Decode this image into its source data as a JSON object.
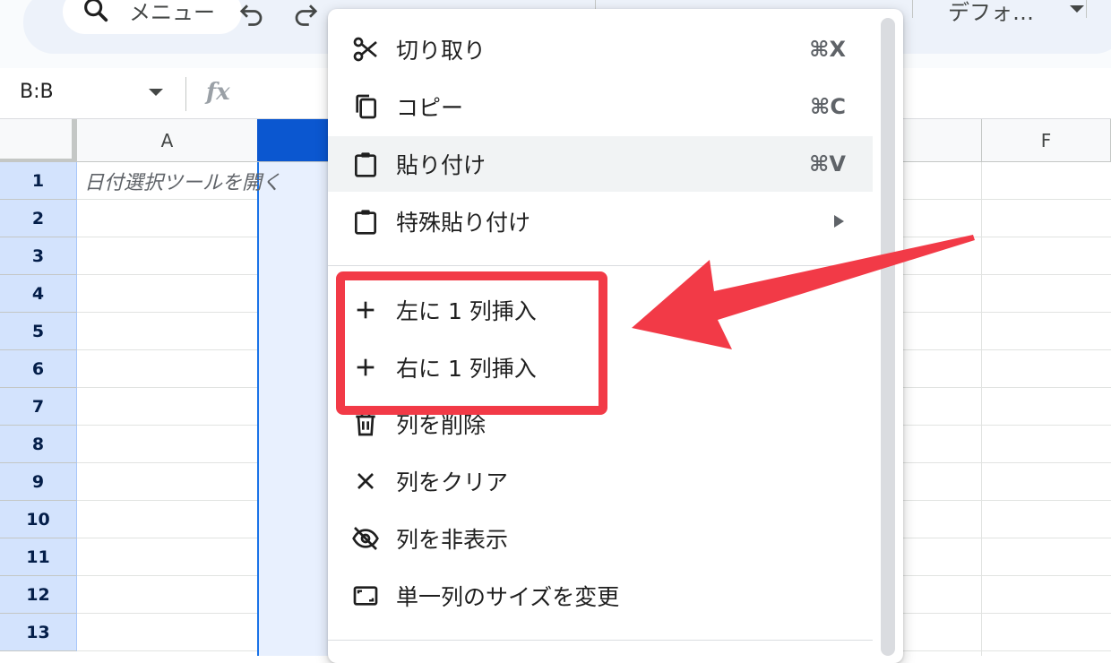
{
  "toolbar": {
    "search_label": "メニュー",
    "font_label": "デフォ…"
  },
  "formula_bar": {
    "name_box": "B:B",
    "fx": "fx"
  },
  "grid": {
    "columns": [
      "A",
      "",
      "",
      "",
      "",
      "F"
    ],
    "rows": [
      "1",
      "2",
      "3",
      "4",
      "5",
      "6",
      "7",
      "8",
      "9",
      "10",
      "11",
      "12",
      "13"
    ],
    "cell_A1": "日付選択ツールを開く"
  },
  "context_menu": {
    "items": [
      {
        "label": "切り取り",
        "shortcut": "⌘X",
        "icon": "scissors-icon"
      },
      {
        "label": "コピー",
        "shortcut": "⌘C",
        "icon": "copy-icon"
      },
      {
        "label": "貼り付け",
        "shortcut": "⌘V",
        "icon": "paste-icon"
      },
      {
        "label": "特殊貼り付け",
        "shortcut": "",
        "icon": "paste-special-icon"
      },
      {
        "label": "左に 1 列挿入",
        "shortcut": "",
        "icon": "plus-icon"
      },
      {
        "label": "右に 1 列挿入",
        "shortcut": "",
        "icon": "plus-icon"
      },
      {
        "label": "列を削除",
        "shortcut": "",
        "icon": "trash-icon"
      },
      {
        "label": "列をクリア",
        "shortcut": "",
        "icon": "close-icon"
      },
      {
        "label": "列を非表示",
        "shortcut": "",
        "icon": "eye-off-icon"
      },
      {
        "label": "単一列のサイズを変更",
        "shortcut": "",
        "icon": "resize-icon"
      }
    ]
  },
  "colors": {
    "annotation": "#f23a47",
    "selection": "#0b57d0",
    "row_header": "#d3e3fd"
  }
}
